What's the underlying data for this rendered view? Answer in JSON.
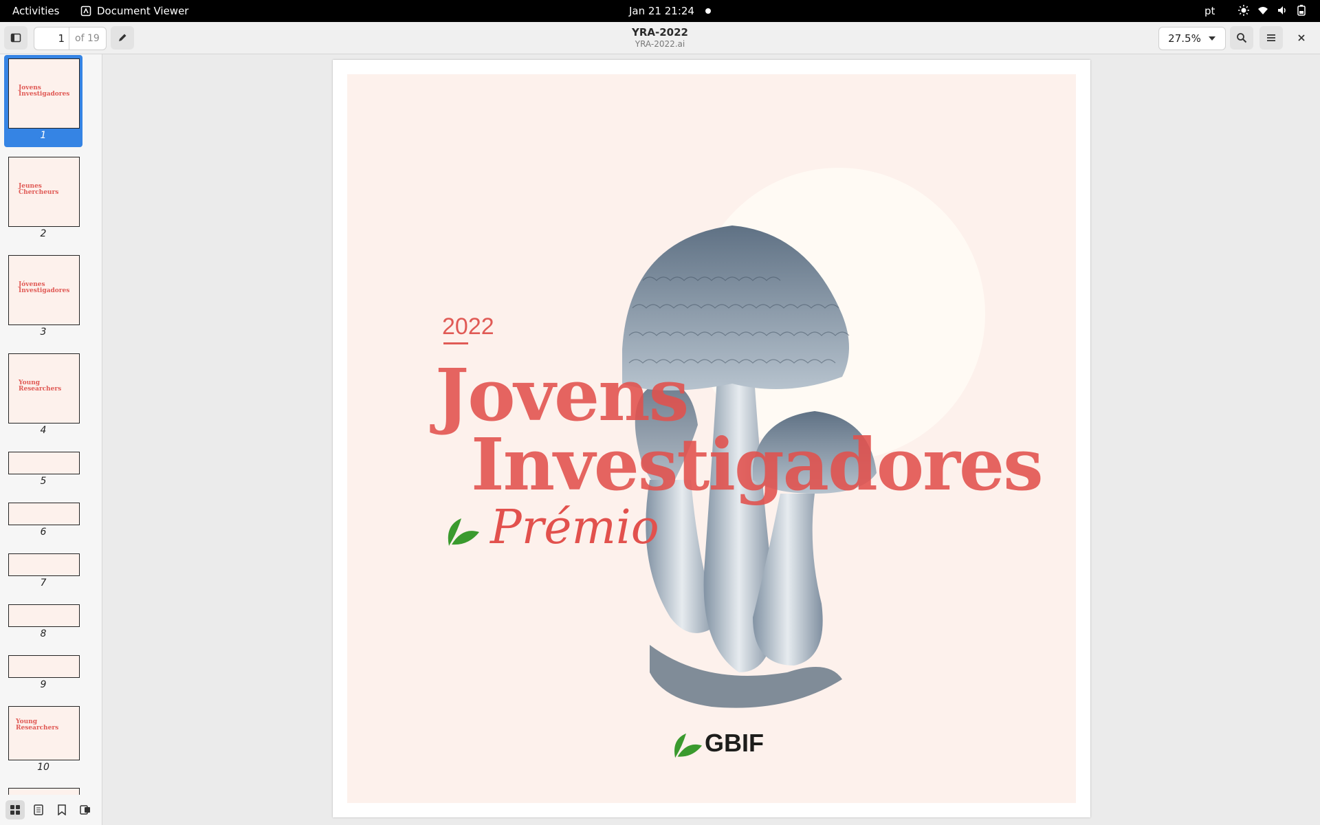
{
  "topbar": {
    "activities": "Activities",
    "app_name": "Document Viewer",
    "clock": "Jan 21  21:24",
    "language": "pt"
  },
  "header": {
    "page_current": "1",
    "page_total": "of 19",
    "title": "YRA-2022",
    "subtitle": "YRA-2022.ai",
    "zoom": "27.5%"
  },
  "sidebar": {
    "thumbnails": [
      {
        "num": "1",
        "title": "Jovens Investigadores"
      },
      {
        "num": "2",
        "title": "Jeunes Chercheurs"
      },
      {
        "num": "3",
        "title": "Jóvenes Investigadores"
      },
      {
        "num": "4",
        "title": "Young Researchers"
      },
      {
        "num": "5",
        "title": ""
      },
      {
        "num": "6",
        "title": ""
      },
      {
        "num": "7",
        "title": ""
      },
      {
        "num": "8",
        "title": ""
      },
      {
        "num": "9",
        "title": ""
      },
      {
        "num": "10",
        "title": "Young Researchers"
      }
    ]
  },
  "poster": {
    "year": "2022",
    "title_line1": "Jovens",
    "title_line2": "Investigadores",
    "subtitle": "Prémio",
    "logo_text": "GBIF"
  },
  "colors": {
    "accent": "#3584e4",
    "poster_bg": "#fdf1ec",
    "title_red": "#e2514d",
    "leaf_green": "#3a9a2e"
  }
}
